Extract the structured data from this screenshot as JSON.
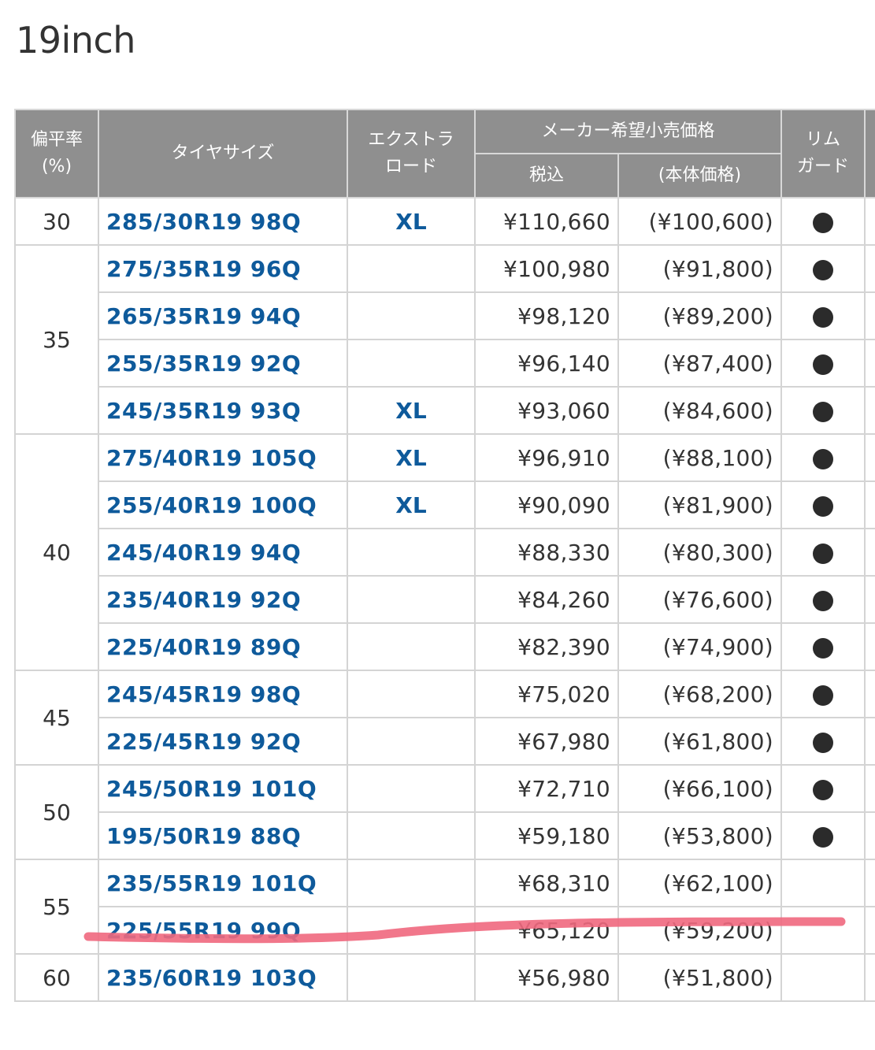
{
  "title": "19inch",
  "header": {
    "ratio": "偏平率",
    "ratio_unit": "(%)",
    "size": "タイヤサイズ",
    "extra_load_1": "エクストラ",
    "extra_load_2": "ロード",
    "msrp": "メーカー希望小売価格",
    "tax_incl": "税込",
    "base_price": "(本体価格)",
    "rim_guard_1": "リム",
    "rim_guard_2": "ガード"
  },
  "rows": [
    {
      "ratio": "30",
      "ratio_span": 1,
      "size": "285/30R19 98Q",
      "xl": "XL",
      "price": "¥110,660",
      "base": "(¥100,600)",
      "rim_guard": true
    },
    {
      "ratio": "35",
      "ratio_span": 4,
      "size": "275/35R19 96Q",
      "xl": "",
      "price": "¥100,980",
      "base": "(¥91,800)",
      "rim_guard": true
    },
    {
      "size": "265/35R19 94Q",
      "xl": "",
      "price": "¥98,120",
      "base": "(¥89,200)",
      "rim_guard": true
    },
    {
      "size": "255/35R19 92Q",
      "xl": "",
      "price": "¥96,140",
      "base": "(¥87,400)",
      "rim_guard": true
    },
    {
      "size": "245/35R19 93Q",
      "xl": "XL",
      "price": "¥93,060",
      "base": "(¥84,600)",
      "rim_guard": true
    },
    {
      "ratio": "40",
      "ratio_span": 5,
      "size": "275/40R19 105Q",
      "xl": "XL",
      "price": "¥96,910",
      "base": "(¥88,100)",
      "rim_guard": true
    },
    {
      "size": "255/40R19 100Q",
      "xl": "XL",
      "price": "¥90,090",
      "base": "(¥81,900)",
      "rim_guard": true
    },
    {
      "size": "245/40R19 94Q",
      "xl": "",
      "price": "¥88,330",
      "base": "(¥80,300)",
      "rim_guard": true
    },
    {
      "size": "235/40R19 92Q",
      "xl": "",
      "price": "¥84,260",
      "base": "(¥76,600)",
      "rim_guard": true
    },
    {
      "size": "225/40R19 89Q",
      "xl": "",
      "price": "¥82,390",
      "base": "(¥74,900)",
      "rim_guard": true
    },
    {
      "ratio": "45",
      "ratio_span": 2,
      "size": "245/45R19 98Q",
      "xl": "",
      "price": "¥75,020",
      "base": "(¥68,200)",
      "rim_guard": true
    },
    {
      "size": "225/45R19 92Q",
      "xl": "",
      "price": "¥67,980",
      "base": "(¥61,800)",
      "rim_guard": true
    },
    {
      "ratio": "50",
      "ratio_span": 2,
      "size": "245/50R19 101Q",
      "xl": "",
      "price": "¥72,710",
      "base": "(¥66,100)",
      "rim_guard": true
    },
    {
      "size": "195/50R19 88Q",
      "xl": "",
      "price": "¥59,180",
      "base": "(¥53,800)",
      "rim_guard": true
    },
    {
      "ratio": "55",
      "ratio_span": 2,
      "size": "235/55R19 101Q",
      "xl": "",
      "price": "¥68,310",
      "base": "(¥62,100)",
      "rim_guard": false
    },
    {
      "size": "225/55R19 99Q",
      "xl": "",
      "price": "¥65,120",
      "base": "(¥59,200)",
      "rim_guard": false
    },
    {
      "ratio": "60",
      "ratio_span": 1,
      "size": "235/60R19 103Q",
      "xl": "",
      "price": "¥56,980",
      "base": "(¥51,800)",
      "rim_guard": false
    }
  ],
  "colors": {
    "header_bg": "#8f8f8f",
    "link": "#0e5a9b",
    "annotation_stroke": "#f0687e"
  }
}
